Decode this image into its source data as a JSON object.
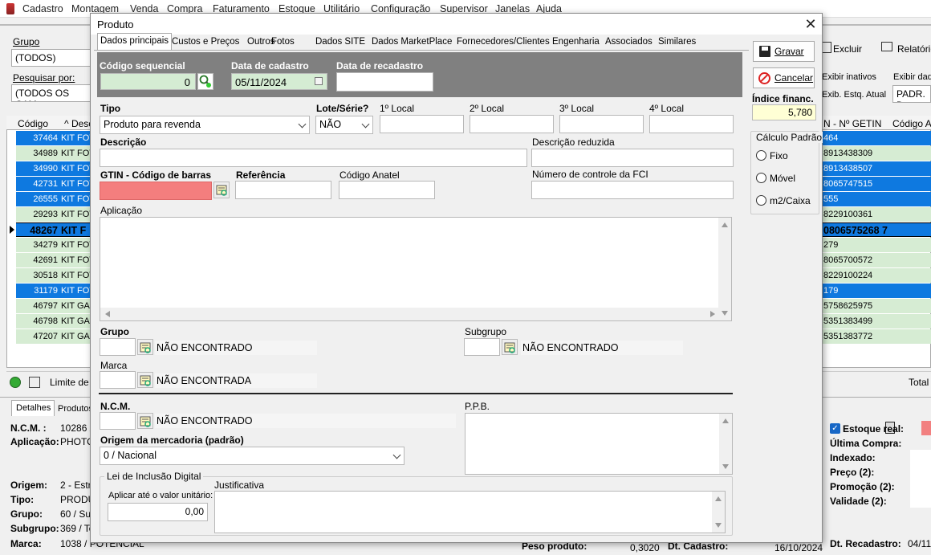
{
  "app": {
    "menu": [
      "Cadastro",
      "Montagem",
      "Venda",
      "Compra",
      "Faturamento",
      "Estoque",
      "Utilitário",
      "Configuração",
      "Supervisor",
      "Janelas",
      "Ajuda"
    ],
    "grupo_label": "Grupo",
    "grupo_value": "(TODOS)",
    "pesquisar_label": "Pesquisar por:",
    "pesquisar_value": "(TODOS OS CAM",
    "toolbar": {
      "excluir": "Excluir",
      "relatorio": "Relatório",
      "exibir_inativos": "Exibir inativos",
      "exibir_dad": "Exibir dad",
      "exib_estq": "Exib. Estq. Atual",
      "padr": "PADR. D"
    },
    "grid_headers": {
      "codigo": "Código",
      "desc": "^ Desc",
      "getin": "N - Nº GETIN",
      "codigo2": "Código A"
    },
    "rows": [
      {
        "code": "37464",
        "desc": "KIT FOT",
        "getin": "464",
        "style": "blue"
      },
      {
        "code": "34989",
        "desc": "KIT FOT",
        "getin": "8913438309",
        "style": "green"
      },
      {
        "code": "34990",
        "desc": "KIT FOT",
        "getin": "8913438507",
        "style": "blue"
      },
      {
        "code": "42731",
        "desc": "KIT FOT",
        "getin": "8065747515",
        "style": "blue"
      },
      {
        "code": "26555",
        "desc": "KIT FOT",
        "getin": "555",
        "style": "blue"
      },
      {
        "code": "29293",
        "desc": "KIT FOT",
        "getin": "8229100361",
        "style": "green"
      },
      {
        "code": "48267",
        "desc": "KIT F",
        "getin": "0806575268 7",
        "style": "sel"
      },
      {
        "code": "34279",
        "desc": "KIT FOT",
        "getin": "279",
        "style": "green"
      },
      {
        "code": "42691",
        "desc": "KIT FOT",
        "getin": "8065700572",
        "style": "green"
      },
      {
        "code": "30518",
        "desc": "KIT FOT",
        "getin": "8229100224",
        "style": "green"
      },
      {
        "code": "31179",
        "desc": "KIT FOT",
        "getin": "179",
        "style": "blue"
      },
      {
        "code": "46797",
        "desc": "KIT GA",
        "getin": "5758625975",
        "style": "green"
      },
      {
        "code": "46798",
        "desc": "KIT GA",
        "getin": "5351383499",
        "style": "green"
      },
      {
        "code": "47207",
        "desc": "KIT GA",
        "getin": "5351383772",
        "style": "green"
      }
    ],
    "limite": "Limite de R",
    "total": "Total",
    "detail_tabs": [
      "Detalhes",
      "Produtos"
    ],
    "details": [
      {
        "k": "N.C.M. :",
        "v": "10286 /"
      },
      {
        "k": "Aplicação:",
        "v": "PHOTO"
      },
      {
        "k": "Origem:",
        "v": "2 - Estra"
      },
      {
        "k": "Tipo:",
        "v": "PRODU"
      },
      {
        "k": "Grupo:",
        "v": "60 / Sup"
      },
      {
        "k": "Subgrupo:",
        "v": "369 / To"
      },
      {
        "k": "Marca:",
        "v": "1038 / POTENCIAL"
      }
    ],
    "right_details": {
      "estoque_real": "Estoque real:",
      "ultima_compra": "Última Compra:",
      "indexado": "Indexado:",
      "preco2": "Preço (2):",
      "promocao2": "Promoção (2):",
      "validade2": "Validade (2):"
    },
    "bottom": {
      "peso_label": "Peso produto:",
      "peso_value": "0,3020",
      "dtcad_label": "Dt. Cadastro:",
      "dtcad_value": "16/10/2024",
      "dtrec_label": "Dt. Recadastro:",
      "dtrec_value": "04/11"
    }
  },
  "dialog": {
    "title": "Produto",
    "tabs": [
      "Dados principais",
      "Custos e Preços",
      "Outros",
      "Fotos",
      "Dados SITE",
      "Dados MarketPlace",
      "Fornecedores/Clientes",
      "Engenharia",
      "Associados",
      "Similares"
    ],
    "codigo_seq_label": "Código sequencial",
    "codigo_seq_value": "0",
    "data_cad_label": "Data de cadastro",
    "data_cad_value": "05/11/2024",
    "data_recad_label": "Data de recadastro",
    "data_recad_value": "",
    "tipo_label": "Tipo",
    "tipo_value": "Produto para revenda",
    "lote_label": "Lote/Série?",
    "lote_value": "NÃO",
    "local1": "1º Local",
    "local2": "2º Local",
    "local3": "3º Local",
    "local4": "4º Local",
    "descricao_label": "Descrição",
    "descricao_reduzida_label": "Descrição reduzida",
    "gtin_label": "GTIN - Código de barras",
    "referencia_label": "Referência",
    "anatel_label": "Código Anatel",
    "fci_label": "Número de controle da FCI",
    "aplicacao_label": "Aplicação",
    "grupo_label": "Grupo",
    "grupo_value": "NÃO ENCONTRADO",
    "subgrupo_label": "Subgrupo",
    "subgrupo_value": "NÃO ENCONTRADO",
    "marca_label": "Marca",
    "marca_value": "NÃO ENCONTRADA",
    "ncm_label": "N.C.M.",
    "ncm_value": "NÃO ENCONTRADO",
    "ppb_label": "P.P.B.",
    "origem_label": "Origem da mercadoria (padrão)",
    "origem_value": "0 / Nacional",
    "lei_label": "Lei de Inclusão Digital",
    "aplicar_label": "Aplicar até o valor unitário:",
    "aplicar_value": "0,00",
    "justificativa_label": "Justificativa",
    "gravar": "Gravar",
    "cancelar": "Cancelar",
    "indice_label": "Índice financ.",
    "indice_value": "5,780",
    "calculo_label": "Cálculo Padrão",
    "calc_fixo": "Fixo",
    "calc_movel": "Móvel",
    "calc_m2": "m2/Caixa"
  }
}
